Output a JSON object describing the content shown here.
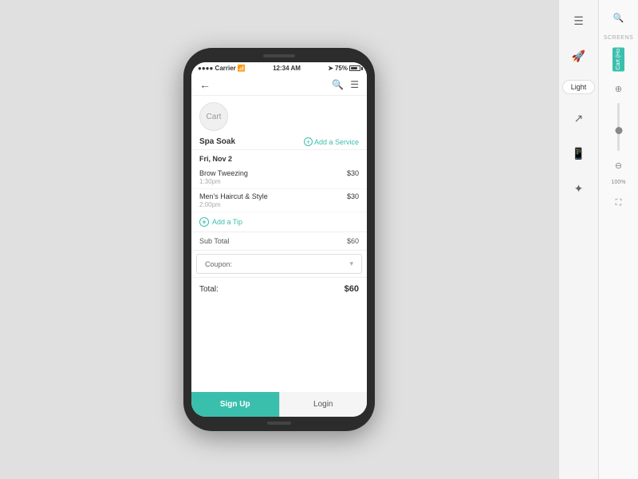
{
  "status_bar": {
    "carrier": "●●●● Carrier",
    "wifi": "▼",
    "time": "12:34 AM",
    "location": "▲",
    "battery_percent": "75%"
  },
  "cart": {
    "title": "Cart",
    "service_name": "Spa Soak",
    "add_service_label": "Add a Service",
    "date": "Fri, Nov 2",
    "items": [
      {
        "name": "Brow Tweezing",
        "time": "1:30pm",
        "price": "$30"
      },
      {
        "name": "Men's Haircut & Style",
        "time": "2:00pm",
        "price": "$30"
      }
    ],
    "add_tip_label": "Add a Tip",
    "subtotal_label": "Sub Total",
    "subtotal_value": "$60",
    "coupon_label": "Coupon:",
    "total_label": "Total:",
    "total_value": "$60",
    "signup_label": "Sign Up",
    "login_label": "Login"
  },
  "toolbar": {
    "light_button": "Light",
    "screens_label": "SCREENS",
    "screen_tab": "Cart (Ho",
    "zoom_percent": "100%"
  }
}
